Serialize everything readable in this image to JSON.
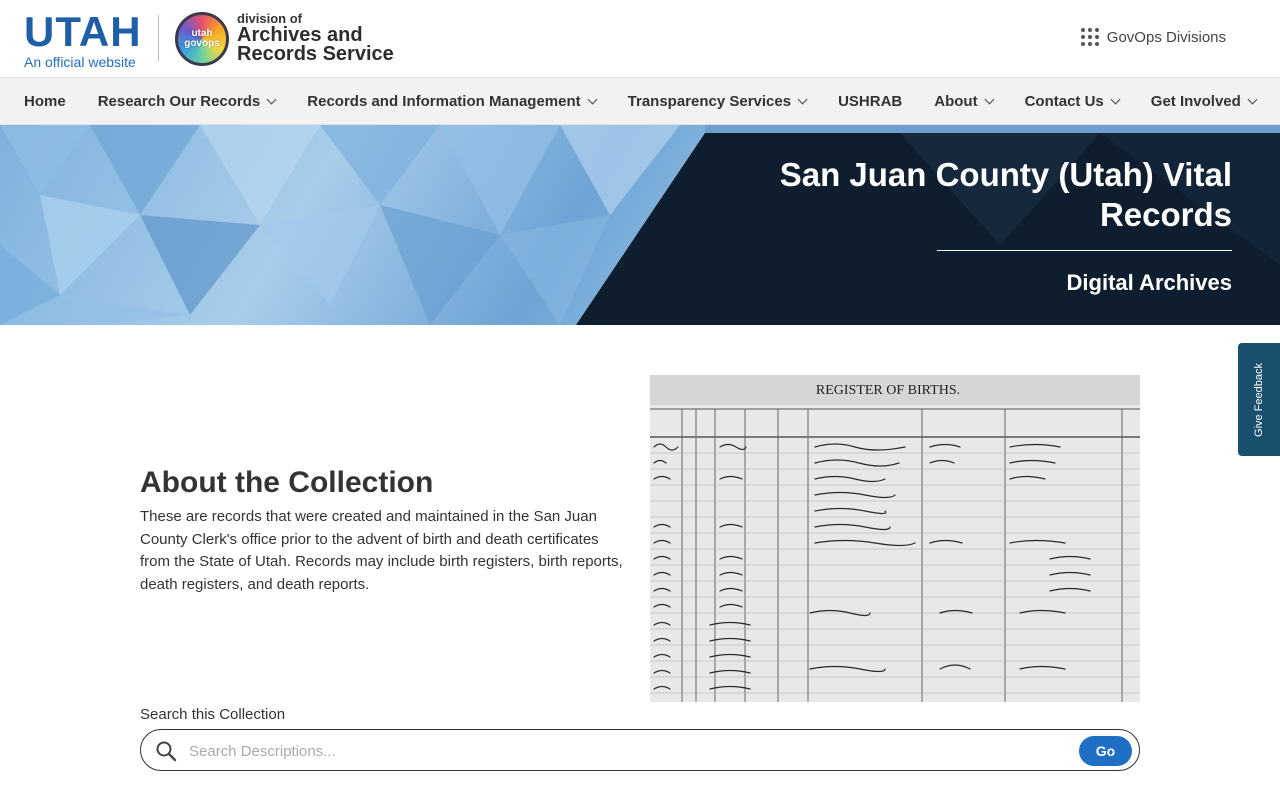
{
  "header": {
    "utah_word": "UTAH",
    "official_text": "An official website",
    "logo_text": "utah govops",
    "division_small": "division of",
    "division_line1": "Archives and",
    "division_line2": "Records Service",
    "govops_divisions_label": "GovOps Divisions"
  },
  "nav": {
    "items": [
      {
        "label": "Home",
        "dropdown": false
      },
      {
        "label": "Research Our Records",
        "dropdown": true
      },
      {
        "label": "Records and Information Management",
        "dropdown": true
      },
      {
        "label": "Transparency Services",
        "dropdown": true
      },
      {
        "label": "USHRAB",
        "dropdown": false
      },
      {
        "label": "About",
        "dropdown": true
      },
      {
        "label": "Contact Us",
        "dropdown": true
      },
      {
        "label": "Get Involved",
        "dropdown": true
      }
    ]
  },
  "hero": {
    "title": "San Juan County (Utah) Vital Records",
    "subtitle": "Digital Archives"
  },
  "feedback": {
    "label": "Give Feedback"
  },
  "about": {
    "title": "About the Collection",
    "body": "These are records that were created and maintained in the San Juan County Clerk's office prior to the advent of birth and death certificates from the State of Utah. Records may include birth registers, birth reports, death registers, and death reports."
  },
  "register_image": {
    "heading": "REGISTER OF BIRTHS."
  },
  "search": {
    "label": "Search this Collection",
    "placeholder": "Search Descriptions...",
    "value": "",
    "button_label": "Go"
  },
  "colors": {
    "brand_blue": "#1f5fa8",
    "go_button": "#1f6fc4",
    "hero_dark": "#0f1e2e",
    "feedback_tab": "#1b4f6e"
  }
}
